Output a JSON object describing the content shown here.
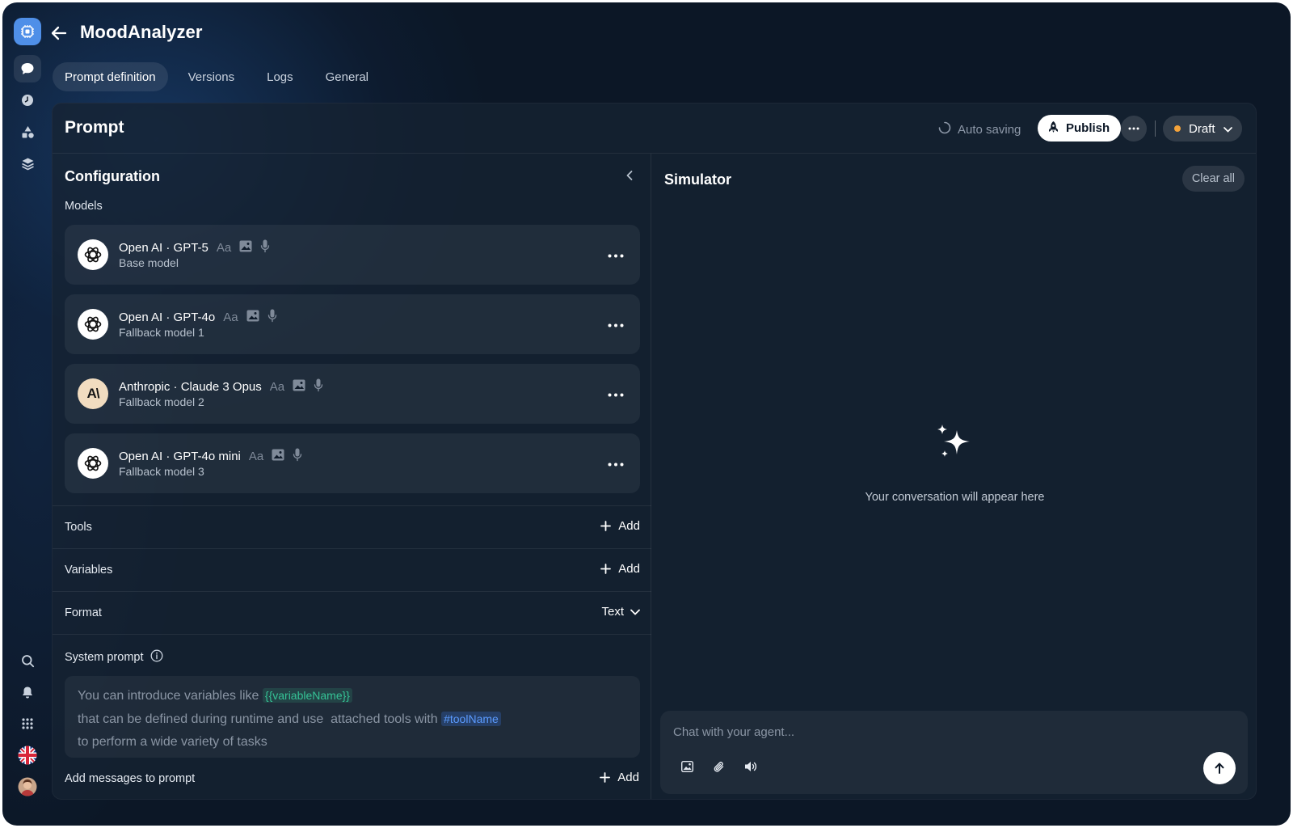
{
  "app": {
    "title": "MoodAnalyzer"
  },
  "tabs": [
    {
      "label": "Prompt definition",
      "active": true
    },
    {
      "label": "Versions",
      "active": false
    },
    {
      "label": "Logs",
      "active": false
    },
    {
      "label": "General",
      "active": false
    }
  ],
  "header": {
    "title": "Prompt",
    "autosave_label": "Auto saving",
    "publish_label": "Publish",
    "status_label": "Draft",
    "status_color": "#f5a33a"
  },
  "config": {
    "title": "Configuration",
    "models_label": "Models",
    "models": [
      {
        "name": "Open AI · GPT-5",
        "role": "Base model",
        "provider": "openai",
        "text_cap": "Aa"
      },
      {
        "name": "Open AI · GPT-4o",
        "role": "Fallback model 1",
        "provider": "openai",
        "text_cap": "Aa"
      },
      {
        "name": "Anthropic · Claude 3 Opus",
        "role": "Fallback model 2",
        "provider": "anthropic",
        "text_cap": "Aa",
        "logo_text": "A\\"
      },
      {
        "name": "Open AI · GPT-4o mini",
        "role": "Fallback model 3",
        "provider": "openai",
        "text_cap": "Aa"
      }
    ],
    "tools_label": "Tools",
    "variables_label": "Variables",
    "format_label": "Format",
    "format_value": "Text",
    "add_label": "Add",
    "system_prompt_label": "System prompt",
    "system_prompt": {
      "line1": "You can introduce variables like",
      "var_chip": "{{variableName}}",
      "line2a": "that can be defined during runtime and use",
      "line2b": "attached tools with",
      "tool_chip": "#toolName",
      "line3": "to perform a wide variety of tasks"
    },
    "add_messages_label": "Add messages to prompt"
  },
  "simulator": {
    "title": "Simulator",
    "clear_label": "Clear all",
    "empty_text": "Your conversation will appear here",
    "chat_placeholder": "Chat with your agent..."
  },
  "colors": {
    "accent": "#4f8fe8",
    "background": "#0c1726",
    "variable_chip": "#35c396",
    "tool_chip": "#5b9bff"
  }
}
